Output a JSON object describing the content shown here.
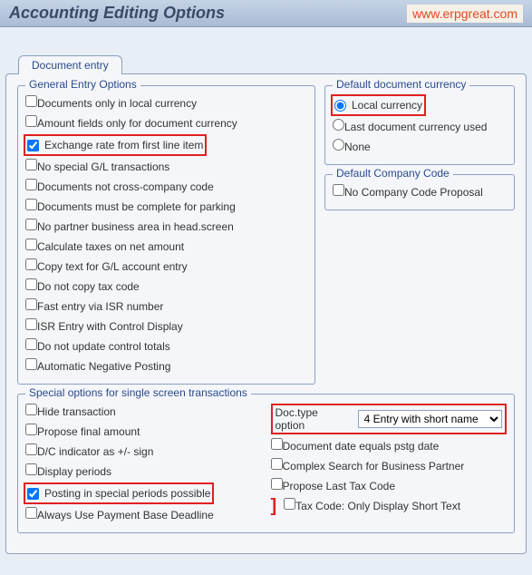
{
  "title": "Accounting Editing Options",
  "watermark": "www.erpgreat.com",
  "tab": "Document entry",
  "groups": {
    "general": {
      "legend": "General Entry Options",
      "items": [
        {
          "label": "Documents only in local currency",
          "checked": false,
          "hl": false
        },
        {
          "label": "Amount fields only for document currency",
          "checked": false,
          "hl": false
        },
        {
          "label": "Exchange rate from first line item",
          "checked": true,
          "hl": true
        },
        {
          "label": "No special G/L transactions",
          "checked": false,
          "hl": false
        },
        {
          "label": "Documents not cross-company code",
          "checked": false,
          "hl": false
        },
        {
          "label": "Documents must be complete for parking",
          "checked": false,
          "hl": false
        },
        {
          "label": "No partner business area in head.screen",
          "checked": false,
          "hl": false
        },
        {
          "label": "Calculate taxes on net amount",
          "checked": false,
          "hl": false
        },
        {
          "label": "Copy text for G/L account entry",
          "checked": false,
          "hl": false
        },
        {
          "label": "Do not copy tax code",
          "checked": false,
          "hl": false
        },
        {
          "label": "Fast entry via ISR number",
          "checked": false,
          "hl": false
        },
        {
          "label": "ISR Entry with Control Display",
          "checked": false,
          "hl": false
        },
        {
          "label": "Do not update control totals",
          "checked": false,
          "hl": false
        },
        {
          "label": "Automatic Negative Posting",
          "checked": false,
          "hl": false
        }
      ]
    },
    "defcurr": {
      "legend": "Default document currency",
      "items": [
        {
          "label": "Local currency",
          "checked": true,
          "hl": true
        },
        {
          "label": "Last document currency used",
          "checked": false,
          "hl": false
        },
        {
          "label": "None",
          "checked": false,
          "hl": false
        }
      ]
    },
    "defcc": {
      "legend": "Default Company Code",
      "items": [
        {
          "label": "No Company Code Proposal",
          "checked": false
        }
      ]
    },
    "special": {
      "legend": "Special options for single screen transactions",
      "left": [
        {
          "label": "Hide transaction",
          "checked": false,
          "hl": false
        },
        {
          "label": "Propose final amount",
          "checked": false,
          "hl": false
        },
        {
          "label": "D/C indicator as +/- sign",
          "checked": false,
          "hl": false
        },
        {
          "label": "Display periods",
          "checked": false,
          "hl": false
        },
        {
          "label": "Posting in special periods possible",
          "checked": true,
          "hl": true
        },
        {
          "label": "Always Use Payment Base Deadline",
          "checked": false,
          "hl": false
        }
      ],
      "doctype_label": "Doc.type option",
      "doctype_value": "4 Entry with short name",
      "right": [
        {
          "label": "Document date equals pstg date",
          "checked": false
        },
        {
          "label": "Complex Search for Business Partner",
          "checked": false
        },
        {
          "label": "Propose Last Tax Code",
          "checked": false
        },
        {
          "label": "Tax Code: Only Display Short Text",
          "checked": false,
          "bracket": true
        }
      ]
    }
  }
}
